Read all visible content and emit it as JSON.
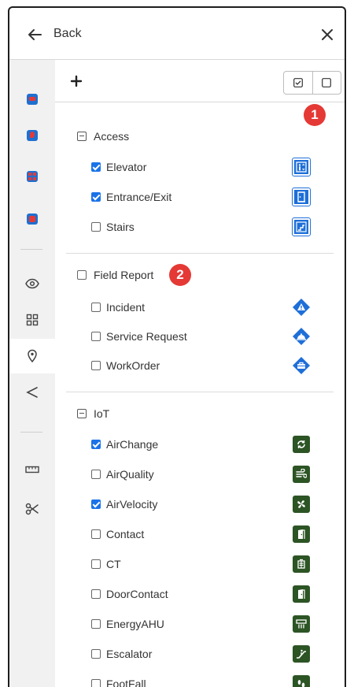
{
  "header": {
    "back_label": "Back"
  },
  "callouts": [
    "1",
    "2"
  ],
  "rail": {
    "items": [
      {
        "name": "layer-red-icon"
      },
      {
        "name": "pin-layer-icon"
      },
      {
        "name": "grid-layer-icon"
      },
      {
        "name": "doc-layer-icon"
      },
      {
        "name": "eye-icon"
      },
      {
        "name": "dashboard-icon"
      },
      {
        "name": "location-pin-icon"
      },
      {
        "name": "share-icon"
      },
      {
        "name": "ruler-icon"
      },
      {
        "name": "scissors-icon"
      }
    ]
  },
  "groups": {
    "access": {
      "label": "Access",
      "items": [
        {
          "label": "Elevator",
          "checked": true,
          "icon": "elevator-icon"
        },
        {
          "label": "Entrance/Exit",
          "checked": true,
          "icon": "door-exit-icon"
        },
        {
          "label": "Stairs",
          "checked": false,
          "icon": "stairs-icon"
        }
      ]
    },
    "field_report": {
      "label": "Field Report",
      "items": [
        {
          "label": "Incident",
          "checked": false,
          "icon": "warning-icon"
        },
        {
          "label": "Service Request",
          "checked": false,
          "icon": "service-bell-icon"
        },
        {
          "label": "WorkOrder",
          "checked": false,
          "icon": "toolbox-icon"
        }
      ]
    },
    "iot": {
      "label": "IoT",
      "items": [
        {
          "label": "AirChange",
          "checked": true,
          "icon": "recycle-icon"
        },
        {
          "label": "AirQuality",
          "checked": false,
          "icon": "wind-icon"
        },
        {
          "label": "AirVelocity",
          "checked": true,
          "icon": "fan-icon"
        },
        {
          "label": "Contact",
          "checked": false,
          "icon": "door-icon"
        },
        {
          "label": "CT",
          "checked": false,
          "icon": "ct-sensor-icon"
        },
        {
          "label": "DoorContact",
          "checked": false,
          "icon": "door-contact-icon"
        },
        {
          "label": "EnergyAHU",
          "checked": false,
          "icon": "ahu-icon"
        },
        {
          "label": "Escalator",
          "checked": false,
          "icon": "escalator-icon"
        },
        {
          "label": "FootFall",
          "checked": false,
          "icon": "footprints-icon"
        }
      ]
    }
  },
  "colors": {
    "accent": "#1a73e8",
    "access_icon": "#1e6fd8",
    "iot_icon": "#2c5424",
    "badge": "#e53935"
  }
}
